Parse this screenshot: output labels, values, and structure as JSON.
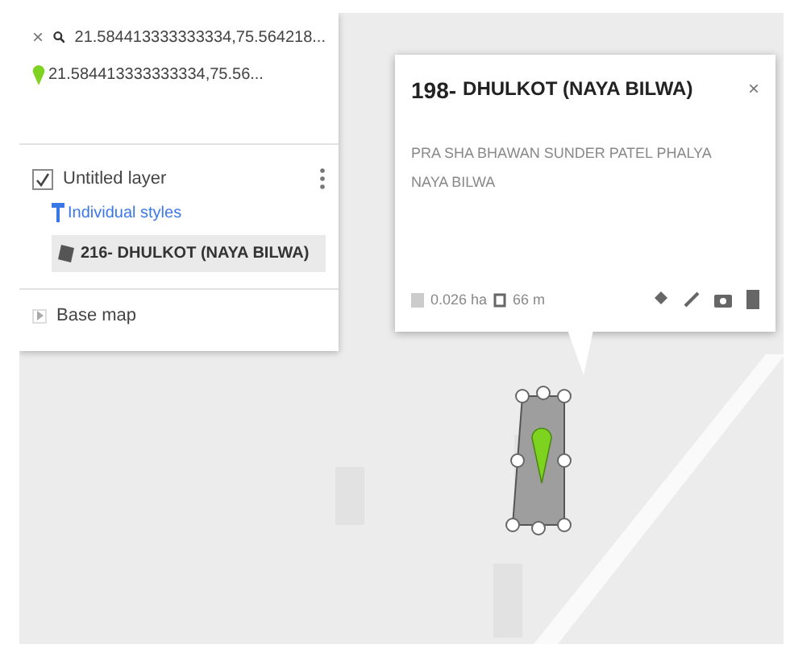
{
  "search": {
    "close": "×",
    "query": "21.584413333333334,75.564218..."
  },
  "result": {
    "text": "21.584413333333334,75.56..."
  },
  "layer": {
    "title": "Untitled layer",
    "checked": true,
    "style_link": "Individual styles",
    "features": [
      {
        "label": "216- DHULKOT (NAYA BILWA)",
        "selected": true
      }
    ]
  },
  "base_map": {
    "label": "Base map",
    "expanded": false
  },
  "popup": {
    "title_number": "198-",
    "title_name": "DHULKOT (NAYA BILWA)",
    "close": "×",
    "description_line_1": "PRA SHA BHAWAN SUNDER PATEL PHALYA",
    "description_line_2": "NAYA BILWA",
    "area": "0.026 ha",
    "perimeter": "66 m"
  }
}
